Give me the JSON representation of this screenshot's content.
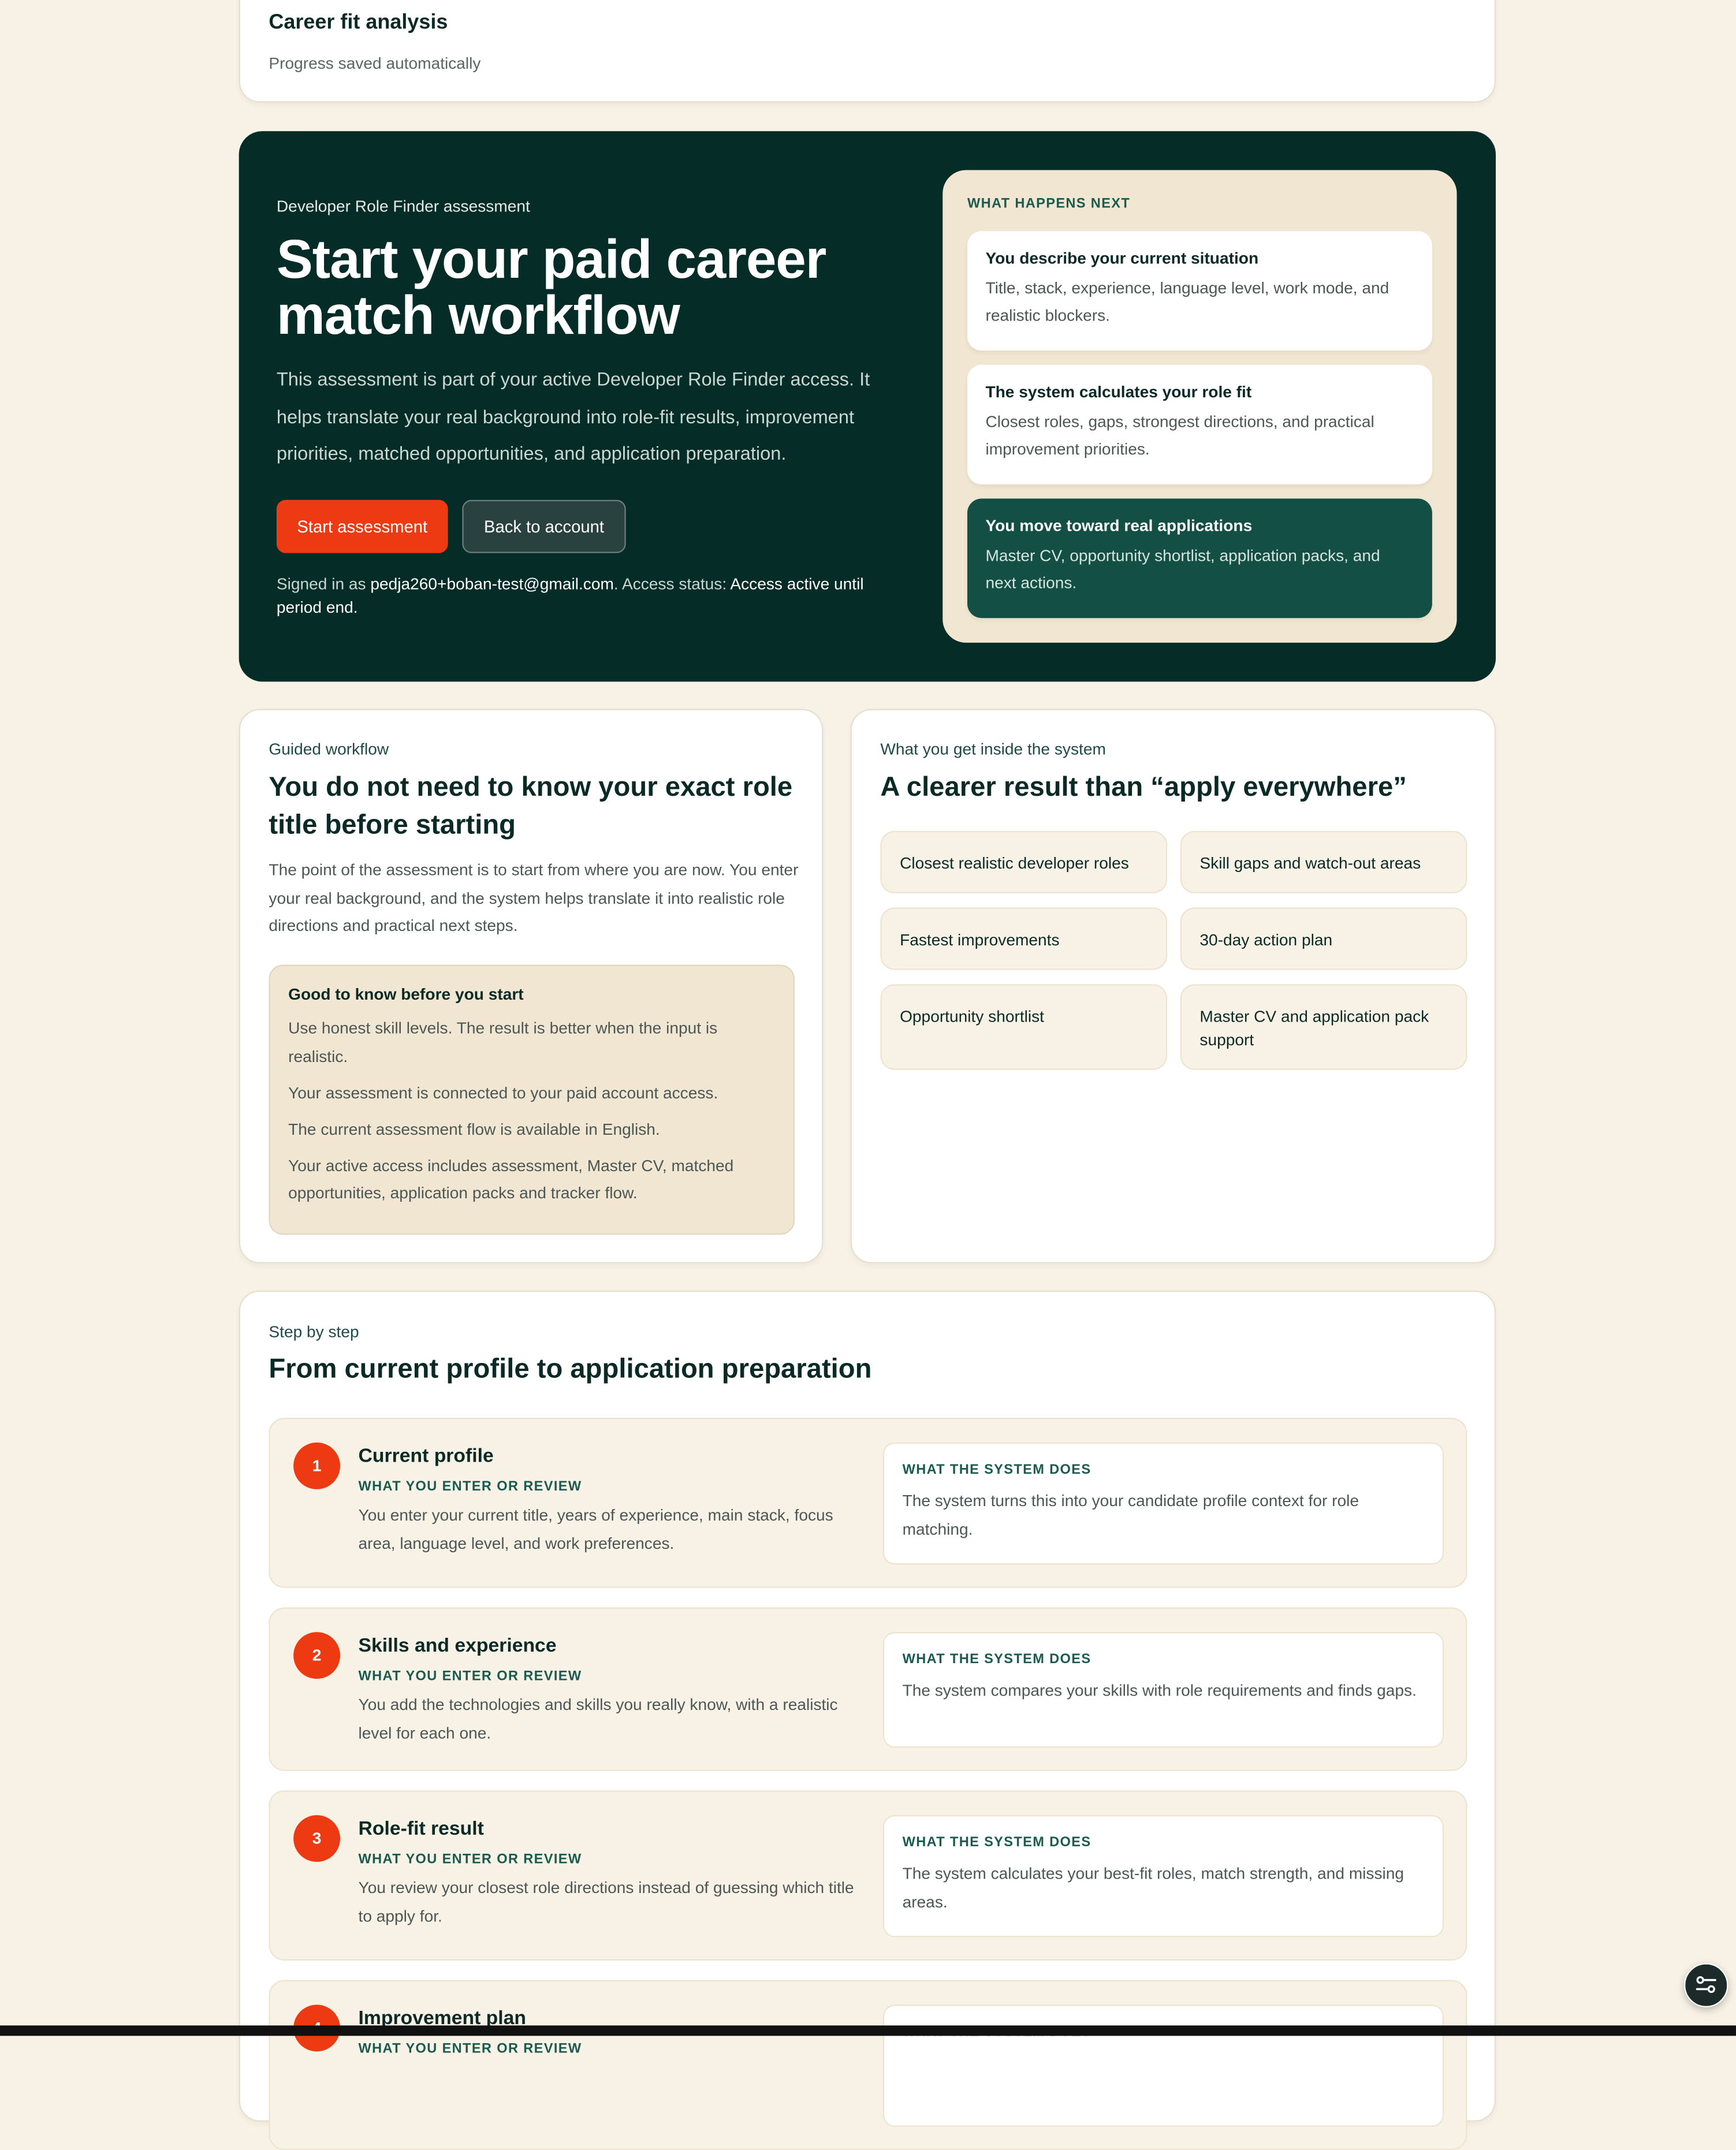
{
  "top": {
    "title": "Career fit analysis",
    "status": "Progress saved automatically"
  },
  "hero": {
    "eyebrow": "Developer Role Finder assessment",
    "title": "Start your paid career match workflow",
    "description": "This assessment is part of your active Developer Role Finder access. It helps translate your real background into role-fit results, improvement priorities, matched opportunities, and application preparation.",
    "primary_button": "Start assessment",
    "secondary_button": "Back to account",
    "signed_prefix": "Signed in as ",
    "email": "pedja260+boban-test@gmail.com",
    "access_prefix": ". Access status: ",
    "access_status": "Access active until period end",
    "signed_suffix": "."
  },
  "next": {
    "label": "WHAT HAPPENS NEXT",
    "items": [
      {
        "title": "You describe your current situation",
        "text": "Title, stack, experience, language level, work mode, and realistic blockers."
      },
      {
        "title": "The system calculates your role fit",
        "text": "Closest roles, gaps, strongest directions, and practical improvement priorities."
      },
      {
        "title": "You move toward real applications",
        "text": "Master CV, opportunity shortlist, application packs, and next actions."
      }
    ]
  },
  "guided": {
    "eyebrow": "Guided workflow",
    "title": "You do not need to know your exact role title before starting",
    "text": "The point of the assessment is to start from where you are now. You enter your real background, and the system helps translate it into realistic role directions and practical next steps.",
    "know_title": "Good to know before you start",
    "know_items": [
      "Use honest skill levels. The result is better when the input is realistic.",
      "Your assessment is connected to your paid account access.",
      "The current assessment flow is available in English.",
      "Your active access includes assessment, Master CV, matched opportunities, application packs and tracker flow."
    ]
  },
  "get": {
    "eyebrow": "What you get inside the system",
    "title": "A clearer result than “apply everywhere”",
    "tiles": [
      "Closest realistic developer roles",
      "Skill gaps and watch-out areas",
      "Fastest improvements",
      "30-day action plan",
      "Opportunity shortlist",
      "Master CV and application pack support"
    ]
  },
  "steps": {
    "eyebrow": "Step by step",
    "title": "From current profile to application preparation",
    "enter_label": "WHAT YOU ENTER OR REVIEW",
    "system_label": "WHAT THE SYSTEM DOES",
    "items": [
      {
        "num": "1",
        "title": "Current profile",
        "enter": "You enter your current title, years of experience, main stack, focus area, language level, and work preferences.",
        "system": "The system turns this into your candidate profile context for role matching."
      },
      {
        "num": "2",
        "title": "Skills and experience",
        "enter": "You add the technologies and skills you really know, with a realistic level for each one.",
        "system": "The system compares your skills with role requirements and finds gaps."
      },
      {
        "num": "3",
        "title": "Role-fit result",
        "enter": "You review your closest role directions instead of guessing which title to apply for.",
        "system": "The system calculates your best-fit roles, match strength, and missing areas."
      },
      {
        "num": "4",
        "title": "Improvement plan",
        "enter": "",
        "system": ""
      }
    ]
  },
  "colors": {
    "accent": "#ee3a12",
    "hero_bg": "#062c28",
    "page_bg": "#f8f2e6",
    "panel_beige": "#f0e6d1",
    "dark_green_card": "#134f45"
  },
  "icons": {
    "fab": "filter-settings-icon"
  }
}
